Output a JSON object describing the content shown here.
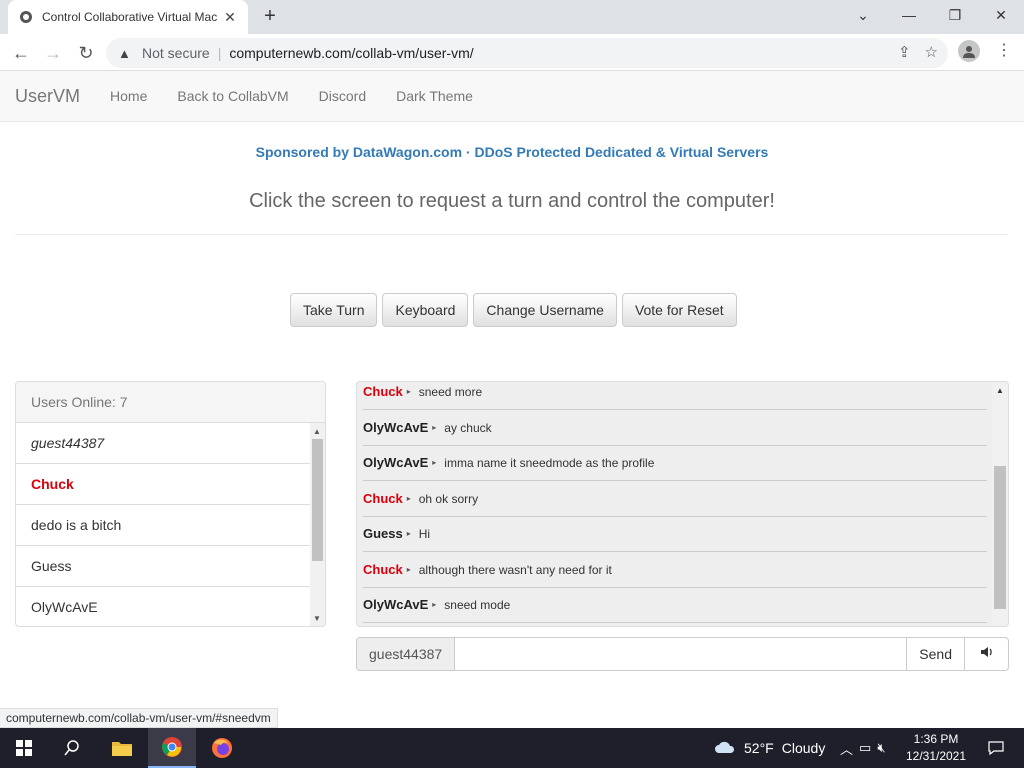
{
  "browser": {
    "tab_title": "Control Collaborative Virtual Mac",
    "tab_close": "✕",
    "new_tab": "+",
    "not_secure": "Not secure",
    "url": "computernewb.com/collab-vm/user-vm/",
    "status_url": "computernewb.com/collab-vm/user-vm/#sneedvm"
  },
  "navbar": {
    "brand": "UserVM",
    "links": [
      "Home",
      "Back to CollabVM",
      "Discord",
      "Dark Theme"
    ]
  },
  "page": {
    "sponsor": "Sponsored by DataWagon.com · DDoS Protected Dedicated & Virtual Servers",
    "lead": "Click the screen to request a turn and control the computer!",
    "buttons": [
      "Take Turn",
      "Keyboard",
      "Change Username",
      "Vote for Reset"
    ]
  },
  "users": {
    "header": "Users Online: 7",
    "list": [
      {
        "name": "guest44387",
        "style": "italic"
      },
      {
        "name": "Chuck",
        "style": "red"
      },
      {
        "name": "dedo is a bitch",
        "style": "normal"
      },
      {
        "name": "Guess",
        "style": "normal"
      },
      {
        "name": "OlyWcAvE",
        "style": "normal"
      }
    ]
  },
  "chat": {
    "messages": [
      {
        "user": "Chuck",
        "red": true,
        "text": "sneed more"
      },
      {
        "user": "OlyWcAvE",
        "red": false,
        "text": "ay chuck"
      },
      {
        "user": "OlyWcAvE",
        "red": false,
        "text": "imma name it sneedmode as the profile"
      },
      {
        "user": "Chuck",
        "red": true,
        "text": "oh ok sorry"
      },
      {
        "user": "Guess",
        "red": false,
        "text": "Hi"
      },
      {
        "user": "Chuck",
        "red": true,
        "text": "although there wasn't any need for it"
      },
      {
        "user": "OlyWcAvE",
        "red": false,
        "text": "sneed mode"
      }
    ],
    "username": "guest44387",
    "input_value": "",
    "send_label": "Send"
  },
  "taskbar": {
    "weather_temp": "52°F",
    "weather_desc": "Cloudy",
    "time": "1:36 PM",
    "date": "12/31/2021"
  },
  "colors": {
    "accent_link": "#337ab7",
    "red_user": "#d9000b",
    "taskbar_bg": "#1f1f2b"
  }
}
